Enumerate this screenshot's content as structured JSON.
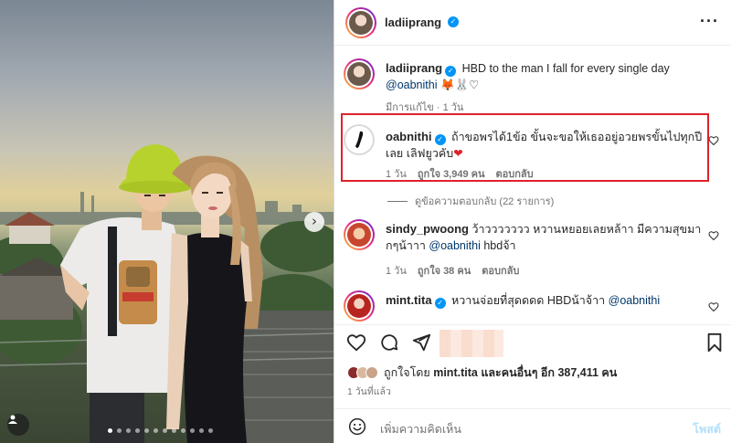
{
  "post": {
    "author": "ladiiprang",
    "next_icon": "chevron-right-icon",
    "carousel_count": 12,
    "carousel_active": 1
  },
  "caption": {
    "username": "ladiiprang",
    "text": "HBD to the man I fall for every single day",
    "mention": "@oabnithi",
    "emoji_tail": "🦊🐰♡",
    "meta": "มีการแก้ไข · 1 วัน"
  },
  "comments": [
    {
      "username": "oabnithi",
      "verified": true,
      "text": "ถ้าขอพรได้1ข้อ ขั้นจะขอให้เธออยู่อวยพรขั้นไปทุกปีเลย เลิฟยูวคับ",
      "text_tail": "❤",
      "time": "1 วัน",
      "likes": "ถูกใจ 3,949 คน",
      "reply": "ตอบกลับ"
    },
    {
      "username": "sindy_pwoong",
      "verified": false,
      "text": "ว้าววววววว หวานหยอยเลยหล้าา มีความสุขมากๆน้าาา",
      "mention": "@oabnithi",
      "text_after": "hbdจ้า",
      "time": "1 วัน",
      "likes": "ถูกใจ 38 คน",
      "reply": "ตอบกลับ"
    },
    {
      "username": "mint.tita",
      "verified": false,
      "text": "หวานจ่อยที่สุดดดด HBDน้าจ้าา",
      "mention": "@oabnithi"
    }
  ],
  "view_replies": "ดูข้อความตอบกลับ (22 รายการ)",
  "likes_summary": {
    "prefix": "ถูกใจโดย",
    "user": "mint.tita",
    "middle": "และคนอื่นๆ อีก",
    "count": "387,411 คน"
  },
  "posted_ago": "1 วันที่แล้ว",
  "comment_box": {
    "placeholder": "เพิ่มความคิดเห็น",
    "post_label": "โพสต์"
  },
  "colors": {
    "verified": "#0095f6",
    "mention": "#00376b",
    "highlight": "#e0212b",
    "heart": "#e0212b",
    "post_disabled": "#b2dffc"
  }
}
